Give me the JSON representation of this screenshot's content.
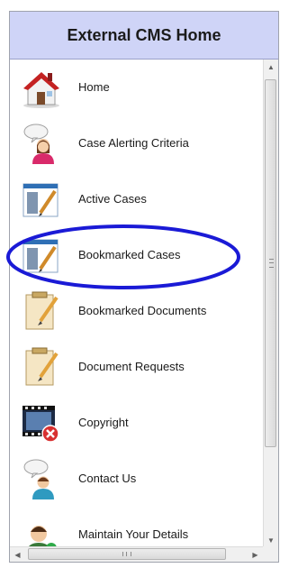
{
  "header": {
    "title": "External CMS Home"
  },
  "menu": {
    "items": [
      {
        "label": "Home",
        "icon": "house-icon"
      },
      {
        "label": "Case Alerting Criteria",
        "icon": "person-speech-icon"
      },
      {
        "label": "Active Cases",
        "icon": "window-pencil-icon"
      },
      {
        "label": "Bookmarked Cases",
        "icon": "window-pencil-icon"
      },
      {
        "label": "Bookmarked Documents",
        "icon": "clipboard-pencil-icon"
      },
      {
        "label": "Document Requests",
        "icon": "clipboard-pencil-icon"
      },
      {
        "label": "Copyright",
        "icon": "film-error-icon"
      },
      {
        "label": "Contact Us",
        "icon": "person-speech-icon"
      },
      {
        "label": "Maintain Your Details",
        "icon": "person-icon"
      }
    ]
  },
  "annotation": {
    "color": "#1a1ad6",
    "target": "Bookmarked Cases"
  }
}
